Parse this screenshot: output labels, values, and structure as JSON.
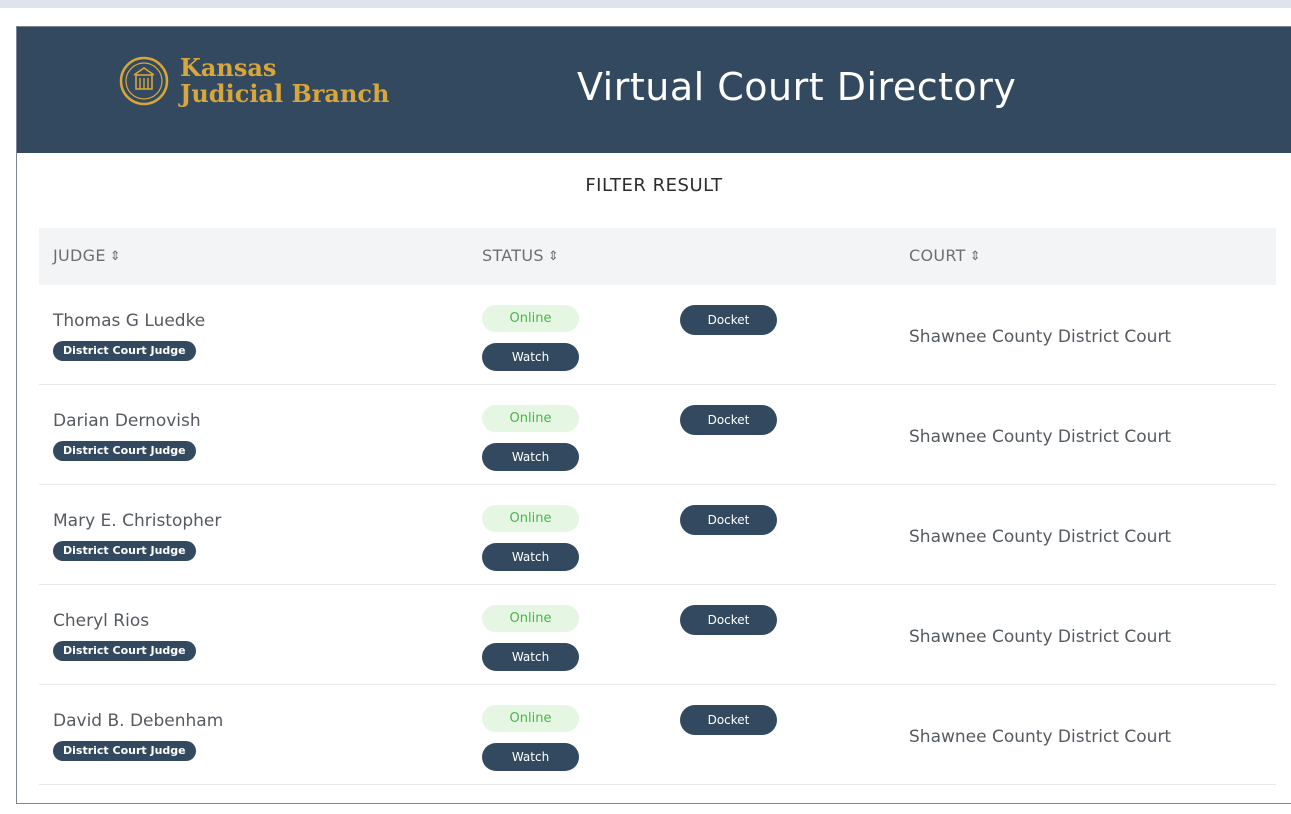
{
  "header": {
    "logo_line1": "Kansas",
    "logo_line2": "Judicial Branch",
    "title": "Virtual Court Directory"
  },
  "filter_title": "FILTER RESULT",
  "columns": {
    "judge": "JUDGE",
    "status": "STATUS",
    "court": "COURT",
    "sort_icon": "⇕"
  },
  "rows": [
    {
      "judge": "Thomas G Luedke",
      "badge": "District Court Judge",
      "status": "Online",
      "watch": "Watch",
      "docket": "Docket",
      "court": "Shawnee County District Court"
    },
    {
      "judge": "Darian Dernovish",
      "badge": "District Court Judge",
      "status": "Online",
      "watch": "Watch",
      "docket": "Docket",
      "court": "Shawnee County District Court"
    },
    {
      "judge": "Mary E. Christopher",
      "badge": "District Court Judge",
      "status": "Online",
      "watch": "Watch",
      "docket": "Docket",
      "court": "Shawnee County District Court"
    },
    {
      "judge": "Cheryl Rios",
      "badge": "District Court Judge",
      "status": "Online",
      "watch": "Watch",
      "docket": "Docket",
      "court": "Shawnee County District Court"
    },
    {
      "judge": "David B. Debenham",
      "badge": "District Court Judge",
      "status": "Online",
      "watch": "Watch",
      "docket": "Docket",
      "court": "Shawnee County District Court"
    }
  ],
  "colors": {
    "header_bg": "#33495f",
    "logo_gold": "#d8a63b",
    "online_bg": "#e5f7e3",
    "online_text": "#47b54a"
  }
}
